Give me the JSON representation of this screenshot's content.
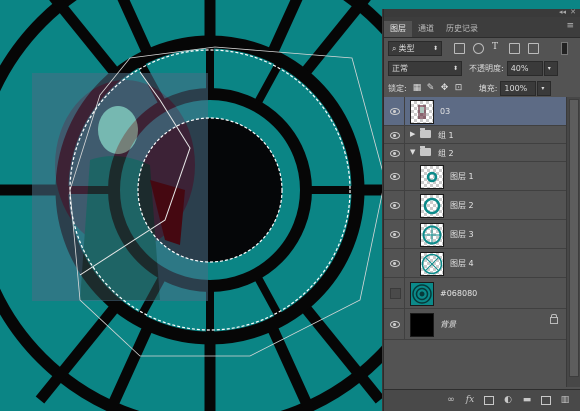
{
  "panel": {
    "tabs": [
      "图层",
      "通道",
      "历史记录"
    ],
    "filter_kind": "类型",
    "blend_mode": "正常",
    "opacity_label": "不透明度:",
    "opacity_value": "40%",
    "lock_label": "锁定:",
    "fill_label": "填充:",
    "fill_value": "100%"
  },
  "layers": [
    {
      "name": "03",
      "type": "image",
      "visible": true,
      "selected": true
    },
    {
      "name": "组 1",
      "type": "group",
      "collapsed": true,
      "visible": true
    },
    {
      "name": "组 2",
      "type": "group",
      "collapsed": false,
      "visible": true
    },
    {
      "name": "图层 1",
      "type": "ring",
      "visible": true,
      "indent": true
    },
    {
      "name": "图层 2",
      "type": "ring",
      "visible": true,
      "indent": true
    },
    {
      "name": "图层 3",
      "type": "ring",
      "visible": true,
      "indent": true
    },
    {
      "name": "图层 4",
      "type": "ring",
      "visible": true,
      "indent": true
    },
    {
      "name": "#068080",
      "type": "fill",
      "visible": false
    },
    {
      "name": "背景",
      "type": "background",
      "visible": true,
      "locked": true
    }
  ],
  "colors": {
    "canvas_bg": "#0b8585",
    "ring": "#060606",
    "panel_bg": "#535353",
    "selected_layer": "#5d6b85"
  },
  "icons": {
    "layer_filter": [
      "image-filter-icon",
      "adjustment-filter-icon",
      "type-filter-icon",
      "shape-filter-icon",
      "smart-object-filter-icon"
    ],
    "locks": [
      "lock-transparent-icon",
      "lock-paint-icon",
      "lock-move-icon",
      "lock-all-icon"
    ],
    "bottom": [
      "link-icon",
      "fx-icon",
      "mask-icon",
      "adjustment-icon",
      "new-group-icon",
      "new-layer-icon",
      "trash-icon"
    ]
  }
}
